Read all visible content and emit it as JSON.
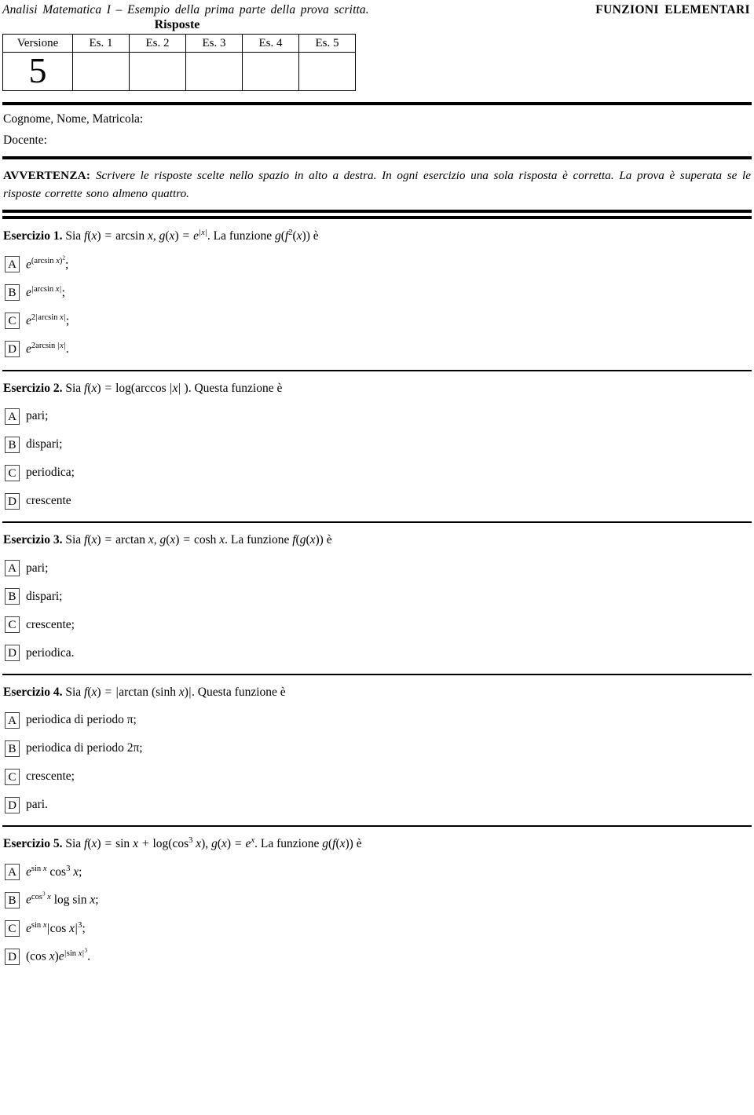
{
  "header": {
    "title_left": "Analisi Matematica I – Esempio della prima parte della prova scritta.",
    "title_right": "FUNZIONI ELEMENTARI",
    "answers_label": "Risposte"
  },
  "version_table": {
    "columns": [
      "Versione",
      "Es. 1",
      "Es. 2",
      "Es. 3",
      "Es. 4",
      "Es. 5"
    ],
    "version_value": "5",
    "answer_cells": [
      "",
      "",
      "",
      "",
      ""
    ]
  },
  "identity": {
    "name_label": "Cognome, Nome, Matricola:",
    "teacher_label": "Docente:"
  },
  "notice": {
    "heading": "AVVERTENZA",
    "separator": ": ",
    "text": "Scrivere le risposte scelte nello spazio in alto a destra. In ogni esercizio una sola risposta è corretta. La prova è superata se le risposte corrette sono almeno quattro."
  },
  "exercises": [
    {
      "label": "Esercizio 1.",
      "statement_plain": "Sia f(x) = arcsin x, g(x) = e^{|x|}. La funzione g(f^2(x)) è",
      "options": [
        {
          "letter": "A",
          "text": "e^{(arcsin x)^2};"
        },
        {
          "letter": "B",
          "text": "e^{|arcsin x|};"
        },
        {
          "letter": "C",
          "text": "e^{2|arcsin x|};"
        },
        {
          "letter": "D",
          "text": "e^{2arcsin |x|}."
        }
      ]
    },
    {
      "label": "Esercizio 2.",
      "statement_plain": "Sia f(x) = log(arccos |x| ). Questa funzione è",
      "options": [
        {
          "letter": "A",
          "text": "pari;"
        },
        {
          "letter": "B",
          "text": "dispari;"
        },
        {
          "letter": "C",
          "text": "periodica;"
        },
        {
          "letter": "D",
          "text": "crescente"
        }
      ]
    },
    {
      "label": "Esercizio 3.",
      "statement_plain": "Sia f(x) = arctan x, g(x) = cosh x. La funzione f(g(x)) è",
      "options": [
        {
          "letter": "A",
          "text": "pari;"
        },
        {
          "letter": "B",
          "text": "dispari;"
        },
        {
          "letter": "C",
          "text": "crescente;"
        },
        {
          "letter": "D",
          "text": "periodica."
        }
      ]
    },
    {
      "label": "Esercizio 4.",
      "statement_plain": "Sia f(x) = |arctan (sinh x)|. Questa funzione è",
      "options": [
        {
          "letter": "A",
          "text": "periodica di periodo π;"
        },
        {
          "letter": "B",
          "text": "periodica di periodo 2π;"
        },
        {
          "letter": "C",
          "text": "crescente;"
        },
        {
          "letter": "D",
          "text": "pari."
        }
      ]
    },
    {
      "label": "Esercizio 5.",
      "statement_plain": "Sia f(x) = sin x + log(cos^3 x), g(x) = e^x. La funzione g(f(x)) è",
      "options": [
        {
          "letter": "A",
          "text": "e^{sin x} cos^3 x;"
        },
        {
          "letter": "B",
          "text": "e^{cos^3 x} log sin x;"
        },
        {
          "letter": "C",
          "text": "e^{sin x}|cos x|^3;"
        },
        {
          "letter": "D",
          "text": "(cos x)e^{|sin x|^3}."
        }
      ]
    }
  ]
}
